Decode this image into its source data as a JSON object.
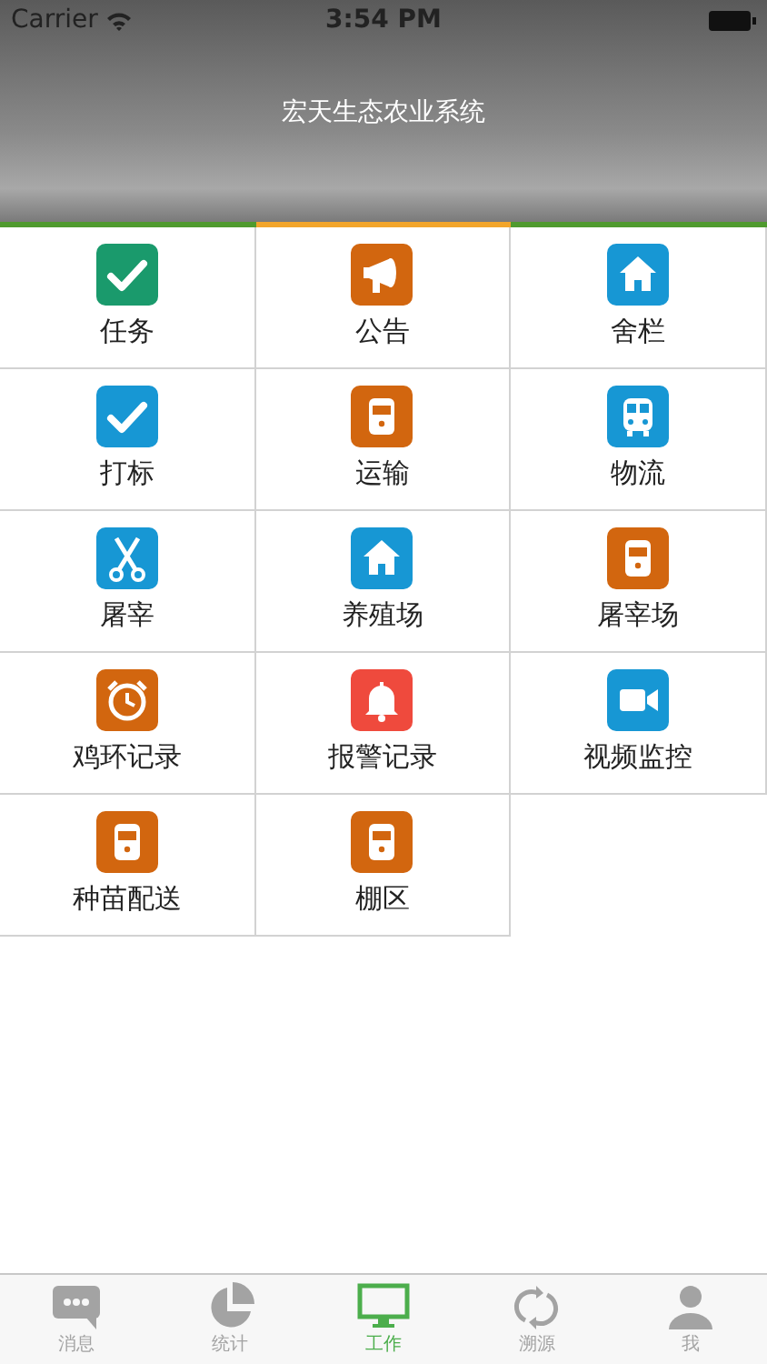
{
  "status_bar": {
    "carrier": "Carrier",
    "time": "3:54 PM"
  },
  "header": {
    "title": "宏天生态农业系统"
  },
  "indicator": [
    {
      "selected": false
    },
    {
      "selected": true
    },
    {
      "selected": false
    }
  ],
  "tiles": [
    {
      "label": "任务",
      "color": "#1a9a6c"
    },
    {
      "label": "公告",
      "color": "#d2660f"
    },
    {
      "label": "舍栏",
      "color": "#1797d4"
    },
    {
      "label": "打标",
      "color": "#1797d4"
    },
    {
      "label": "运输",
      "color": "#d2660f"
    },
    {
      "label": "物流",
      "color": "#1797d4"
    },
    {
      "label": "屠宰",
      "color": "#1797d4"
    },
    {
      "label": "养殖场",
      "color": "#1797d4"
    },
    {
      "label": "屠宰场",
      "color": "#d2660f"
    },
    {
      "label": "鸡环记录",
      "color": "#d2660f"
    },
    {
      "label": "报警记录",
      "color": "#ef4a3d"
    },
    {
      "label": "视频监控",
      "color": "#1797d4"
    },
    {
      "label": "种苗配送",
      "color": "#d2660f"
    },
    {
      "label": "棚区",
      "color": "#d2660f"
    }
  ],
  "tab_bar": [
    {
      "label": "消息",
      "selected": false
    },
    {
      "label": "统计",
      "selected": false
    },
    {
      "label": "工作",
      "selected": true
    },
    {
      "label": "溯源",
      "selected": false
    },
    {
      "label": "我",
      "selected": false
    }
  ]
}
